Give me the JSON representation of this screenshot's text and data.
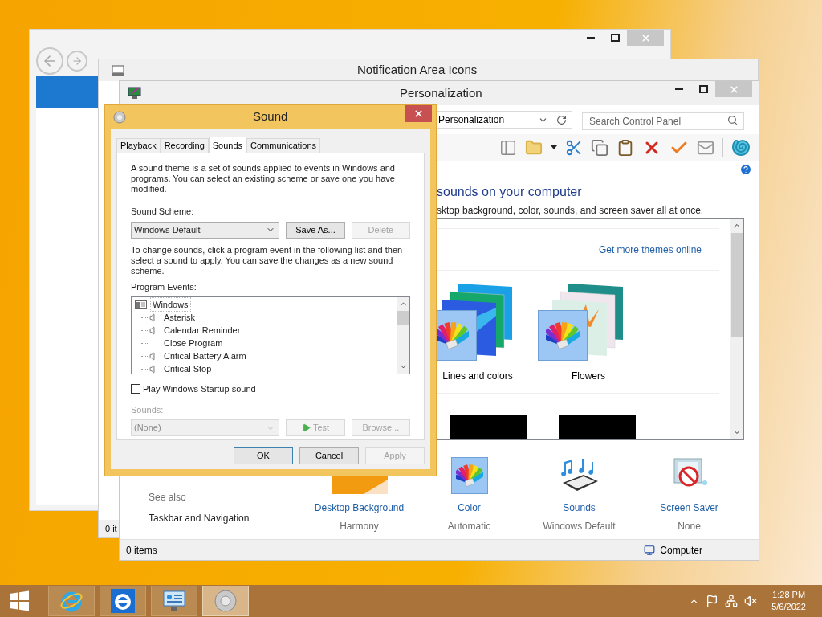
{
  "notification_window": {
    "title": "Notification Area Icons",
    "status_text": "0 it"
  },
  "personalization_window": {
    "title": "Personalization",
    "address": "Personalization",
    "search": {
      "placeholder": "Search Control Panel"
    },
    "heading": "sounds on your computer",
    "description": "sktop background, color, sounds, and screen saver all at once.",
    "themes_link": "Get more themes online",
    "themes": [
      {
        "name": "Lines and colors",
        "kind": "lines"
      },
      {
        "name": "Flowers",
        "kind": "flowers"
      }
    ],
    "see_also": {
      "heading": "See also",
      "links": [
        "Taskbar and Navigation"
      ]
    },
    "settings": [
      {
        "label": "Desktop Background",
        "value": "Harmony",
        "kind": "background"
      },
      {
        "label": "Color",
        "value": "Automatic",
        "kind": "color"
      },
      {
        "label": "Sounds",
        "value": "Windows Default",
        "kind": "sounds"
      },
      {
        "label": "Screen Saver",
        "value": "None",
        "kind": "screensaver"
      }
    ],
    "status_bar": {
      "items": "0 items",
      "location": "Computer"
    }
  },
  "sound_dialog": {
    "title": "Sound",
    "tabs": [
      {
        "label": "Playback",
        "selected": false
      },
      {
        "label": "Recording",
        "selected": false
      },
      {
        "label": "Sounds",
        "selected": true
      },
      {
        "label": "Communications",
        "selected": false
      }
    ],
    "intro": "A sound theme is a set of sounds applied to events in Windows and programs.  You can select an existing scheme or save one you have modified.",
    "scheme_label": "Sound Scheme:",
    "scheme": "Windows Default",
    "scheme_buttons": [
      {
        "label": "Save As...",
        "disabled": false
      },
      {
        "label": "Delete",
        "disabled": true
      }
    ],
    "instructions": "To change sounds, click a program event in the following list and then select a sound to apply.  You can save the changes as a new sound scheme.",
    "events_label": "Program Events:",
    "events": [
      {
        "label": "Windows",
        "kind": "group",
        "children": [
          {
            "label": "Asterisk",
            "kind": "sound"
          },
          {
            "label": "Calendar Reminder",
            "kind": "sound"
          },
          {
            "label": "Close Program",
            "kind": "silent"
          },
          {
            "label": "Critical Battery Alarm",
            "kind": "sound"
          },
          {
            "label": "Critical Stop",
            "kind": "sound"
          }
        ]
      }
    ],
    "startup_sound": {
      "label": "Play Windows Startup sound",
      "checked": false
    },
    "sounds_label": "Sounds:",
    "sound": {
      "value": "(None)",
      "disabled": true
    },
    "sound_buttons": [
      {
        "label": "Test",
        "kind": "play",
        "disabled": true
      },
      {
        "label": "Browse...",
        "kind": "plain",
        "disabled": true
      }
    ],
    "buttons": [
      {
        "label": "OK",
        "default": true,
        "disabled": false
      },
      {
        "label": "Cancel",
        "default": false,
        "disabled": false
      },
      {
        "label": "Apply",
        "default": false,
        "disabled": true
      }
    ]
  },
  "taskbar": {
    "apps": [
      {
        "kind": "ie-modern",
        "selected": false
      },
      {
        "kind": "ie",
        "selected": false
      },
      {
        "kind": "control-panel",
        "selected": false
      },
      {
        "kind": "sound",
        "selected": true
      }
    ],
    "time": "1:28 PM",
    "date": "5/6/2022"
  }
}
